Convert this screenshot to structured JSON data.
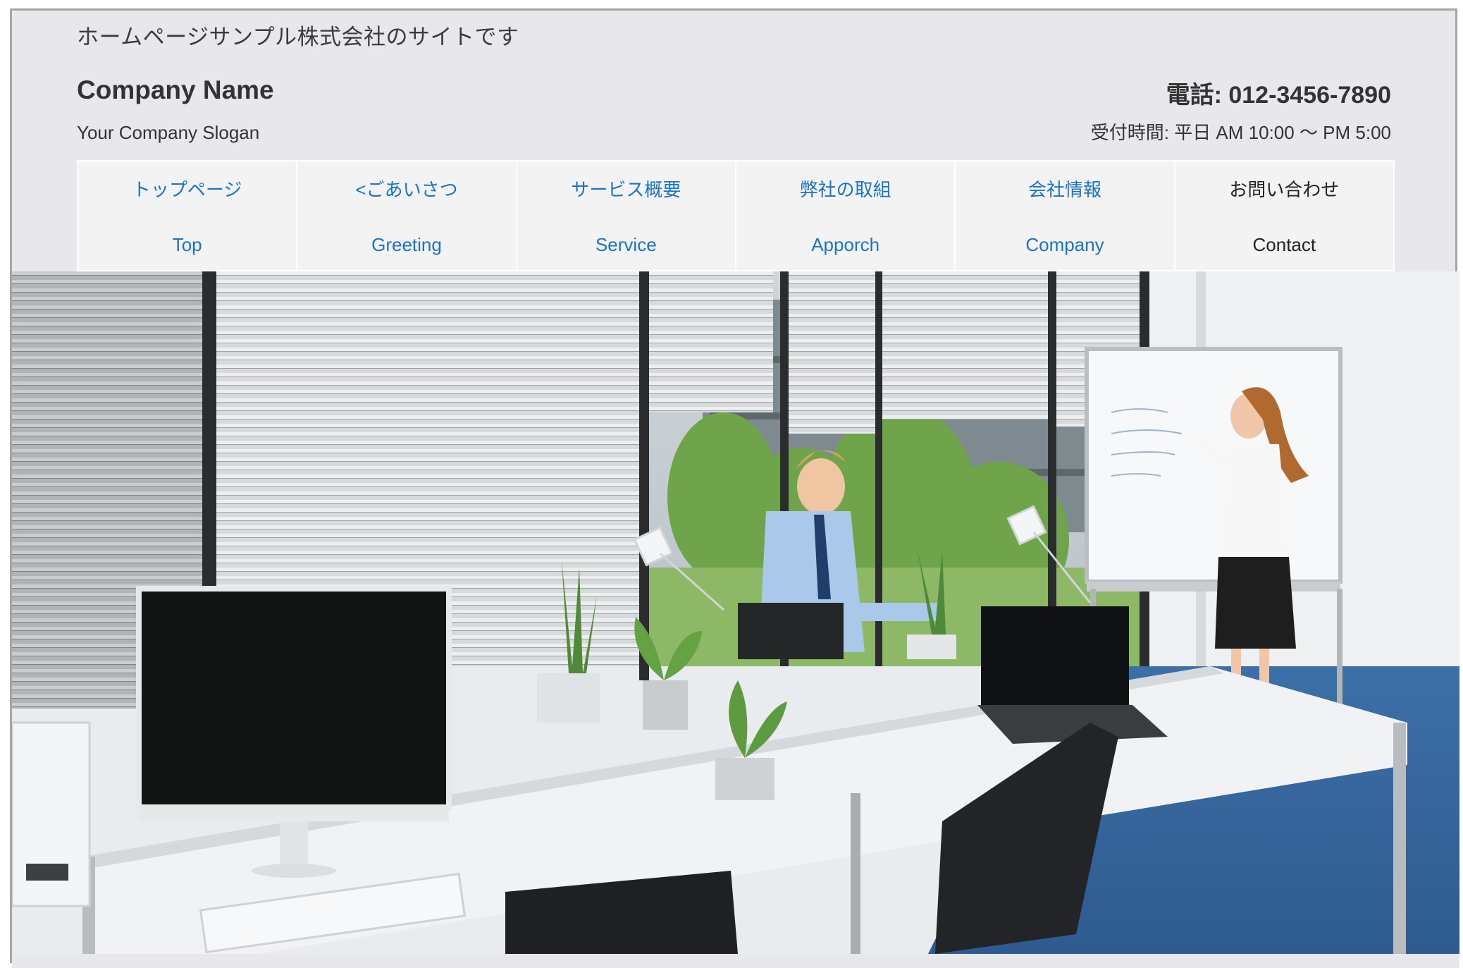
{
  "header": {
    "site_tagline": "ホームページサンプル株式会社のサイトです",
    "company_name": "Company Name",
    "slogan": "Your Company Slogan",
    "phone": "電話: 012-3456-7890",
    "hours": "受付時間: 平日 AM 10:00 〜 PM 5:00"
  },
  "nav": {
    "items": [
      {
        "jp": "トップページ",
        "en": "Top"
      },
      {
        "jp": "<ごあいさつ",
        "en": "Greeting"
      },
      {
        "jp": "サービス概要",
        "en": "Service"
      },
      {
        "jp": "弊社の取組",
        "en": "Apporch"
      },
      {
        "jp": "会社情報",
        "en": "Company"
      },
      {
        "jp": "お問い合わせ",
        "en": "Contact"
      }
    ]
  },
  "colors": {
    "link": "#1a73c8",
    "background": "#e8e8ec",
    "nav_background": "#f3f3f3"
  },
  "hero": {
    "icon": "office-photo"
  }
}
